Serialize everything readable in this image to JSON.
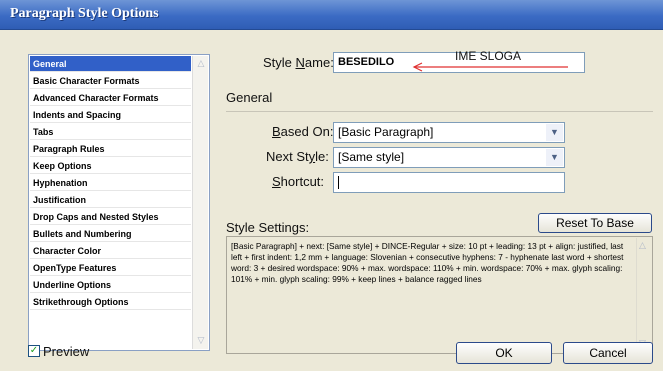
{
  "window": {
    "title": "Paragraph Style Options"
  },
  "sidebar": {
    "items": [
      {
        "label": "General",
        "selected": true
      },
      {
        "label": "Basic Character Formats"
      },
      {
        "label": "Advanced Character Formats"
      },
      {
        "label": "Indents and Spacing"
      },
      {
        "label": "Tabs"
      },
      {
        "label": "Paragraph Rules"
      },
      {
        "label": "Keep Options"
      },
      {
        "label": "Hyphenation"
      },
      {
        "label": "Justification"
      },
      {
        "label": "Drop Caps and Nested Styles"
      },
      {
        "label": "Bullets and Numbering"
      },
      {
        "label": "Character Color"
      },
      {
        "label": "OpenType Features"
      },
      {
        "label": "Underline Options"
      },
      {
        "label": "Strikethrough Options"
      }
    ]
  },
  "style_name": {
    "label_pre": "Style ",
    "label_u": "N",
    "label_post": "ame:",
    "value": "BESEDILO",
    "annotation": "IME SLOGA",
    "annotation_color": "#e03030"
  },
  "general_section": {
    "title": "General"
  },
  "based_on": {
    "label_u": "B",
    "label_post": "ased On:",
    "value": "[Basic Paragraph]"
  },
  "next_style": {
    "label_pre": "Next St",
    "label_u": "y",
    "label_post": "le:",
    "value": "[Same style]"
  },
  "shortcut": {
    "label_u": "S",
    "label_post": "hortcut:",
    "value": ""
  },
  "style_settings": {
    "label": "Style Settings:",
    "reset_label": "Reset To Base",
    "text": "[Basic Paragraph] + next: [Same style] + DINCE-Regular + size: 10 pt + leading: 13 pt + align: justified, last left + first indent: 1,2 mm + language: Slovenian + consecutive hyphens: 7 - hyphenate last word + shortest word: 3 + desired wordspace: 90% + max. wordspace: 110% + min. wordspace: 70% + max. glyph scaling:  101% + min. glyph scaling:   99% + keep lines + balance ragged lines"
  },
  "preview": {
    "label": "Preview",
    "checked": true
  },
  "buttons": {
    "ok": "OK",
    "cancel": "Cancel"
  },
  "colors": {
    "titlebar": "#3b6bc4",
    "selection": "#3160c8"
  }
}
